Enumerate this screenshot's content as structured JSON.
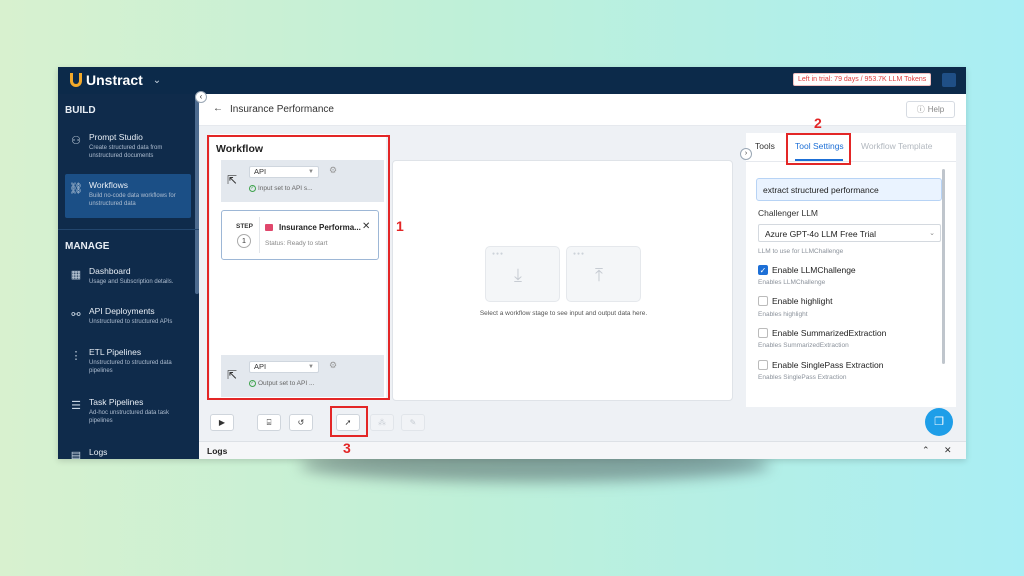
{
  "app": {
    "name": "Unstract",
    "trial_text": "Left in trial: 79 days / 953.7K LLM Tokens"
  },
  "sidebar": {
    "build_heading": "BUILD",
    "manage_heading": "MANAGE",
    "build_items": [
      {
        "title": "Prompt Studio",
        "desc": "Create structured data from unstructured documents",
        "icon": "prompt-studio-icon"
      },
      {
        "title": "Workflows",
        "desc": "Build no-code data workflows for unstructured data",
        "icon": "workflows-icon"
      }
    ],
    "manage_items": [
      {
        "title": "Dashboard",
        "desc": "Usage and Subscription details.",
        "icon": "dashboard-icon"
      },
      {
        "title": "API Deployments",
        "desc": "Unstructured to structured APIs",
        "icon": "api-icon"
      },
      {
        "title": "ETL Pipelines",
        "desc": "Unstructured to structured data pipelines",
        "icon": "etl-icon"
      },
      {
        "title": "Task Pipelines",
        "desc": "Ad-hoc unstructured data task pipelines",
        "icon": "task-icon"
      },
      {
        "title": "Logs",
        "desc": "",
        "icon": "logs-icon"
      }
    ]
  },
  "header": {
    "title": "Insurance Performance",
    "help_label": "Help"
  },
  "workflow": {
    "title": "Workflow",
    "input": {
      "type": "API",
      "status": "Input set to API s..."
    },
    "output": {
      "type": "API",
      "status": "Output set to API ..."
    },
    "step": {
      "label": "STEP",
      "number": "1",
      "name": "Insurance Performa...",
      "status": "Status: Ready to start"
    }
  },
  "io_area": {
    "hint": "Select a workflow stage to see input and output data here."
  },
  "right_panel": {
    "tabs": [
      "Tools",
      "Tool Settings",
      "Workflow Template"
    ],
    "active_tab": "Tool Settings",
    "prompt_value": "extract structured performance",
    "challenger_label": "Challenger LLM",
    "challenger_value": "Azure GPT-4o LLM Free Trial",
    "challenger_hint": "LLM to use for LLMChallenge",
    "options": [
      {
        "label": "Enable LLMChallenge",
        "hint": "Enables LLMChallenge",
        "checked": true
      },
      {
        "label": "Enable highlight",
        "hint": "Enables highlight",
        "checked": false
      },
      {
        "label": "Enable SummarizedExtraction",
        "hint": "Enables SummarizedExtraction",
        "checked": false
      },
      {
        "label": "Enable SinglePass Extraction",
        "hint": "Enables SinglePass Extraction",
        "checked": false
      }
    ]
  },
  "logs": {
    "label": "Logs"
  },
  "annotations": [
    "1",
    "2",
    "3"
  ],
  "colors": {
    "accent": "#1d6fd6",
    "sidebar_bg": "#0f2b4b",
    "annotation_red": "#e32626",
    "fab": "#1e9ee8"
  }
}
